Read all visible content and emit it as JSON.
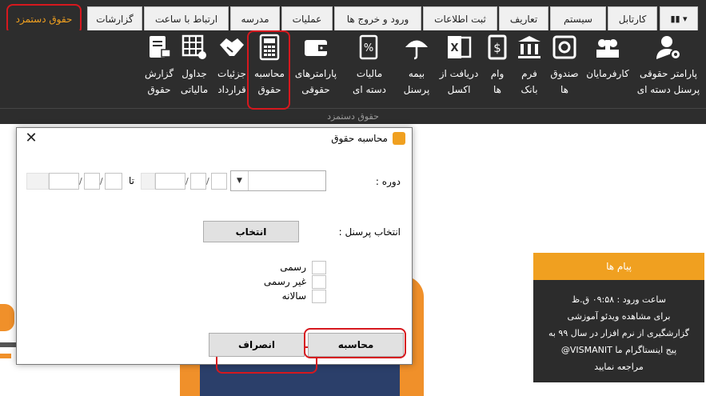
{
  "top_tabs": [
    {
      "label": "",
      "active": false
    },
    {
      "label": "کارتابل",
      "active": false
    },
    {
      "label": "سیستم",
      "active": false
    },
    {
      "label": "تعاریف",
      "active": false
    },
    {
      "label": "ثبت اطلاعات",
      "active": false
    },
    {
      "label": "ورود و خروج ها",
      "active": false
    },
    {
      "label": "عملیات",
      "active": false
    },
    {
      "label": "مدرسه",
      "active": false
    },
    {
      "label": "ارتباط با ساعت",
      "active": false
    },
    {
      "label": "گزارشات",
      "active": false
    },
    {
      "label": "حقوق دستمزد",
      "active": true
    }
  ],
  "ribbon": {
    "group_label": "حقوق دستمزد",
    "buttons": [
      {
        "line1": "پارامتر حقوقی",
        "line2": "پرسنل دسته ای",
        "icon": "user-settings-icon"
      },
      {
        "line1": "کارفرمایان",
        "line2": "",
        "icon": "employers-icon"
      },
      {
        "line1": "صندوق",
        "line2": "ها",
        "icon": "safe-icon"
      },
      {
        "line1": "فرم",
        "line2": "بانک",
        "icon": "bank-icon"
      },
      {
        "line1": "وام",
        "line2": "ها",
        "icon": "loan-icon"
      },
      {
        "line1": "دریافت از",
        "line2": "اکسل",
        "icon": "excel-icon"
      },
      {
        "line1": "بیمه",
        "line2": "پرسنل",
        "icon": "umbrella-icon"
      },
      {
        "line1": "مالیات",
        "line2": "دسته ای",
        "icon": "tax-icon"
      },
      {
        "line1": "پارامترهای",
        "line2": "حقوقی",
        "icon": "wallet-icon"
      },
      {
        "line1": "محاسبه",
        "line2": "حقوق",
        "icon": "calculator-icon"
      },
      {
        "line1": "جزئیات",
        "line2": "قرارداد",
        "icon": "handshake-icon"
      },
      {
        "line1": "جداول",
        "line2": "مالیاتی",
        "icon": "table-icon"
      },
      {
        "line1": "گزارش",
        "line2": "حقوق",
        "icon": "report-icon"
      }
    ]
  },
  "dialog": {
    "title": "محاسبه حقوق",
    "period_label": "دوره :",
    "to_label": "تا",
    "personnel_label": "انتخاب پرسنل :",
    "select_button": "انتخاب",
    "checkboxes": [
      {
        "label": "رسمی",
        "checked": false
      },
      {
        "label": "غیر رسمی",
        "checked": false
      },
      {
        "label": "سالانه",
        "checked": false
      }
    ],
    "calculate_button": "محاسبه",
    "cancel_button": "انصراف"
  },
  "messages": {
    "header": "پیام ها",
    "lines": [
      "ساعت ورود : ۰۹:۵۸ ق.ظ",
      "برای مشاهده ویدئو آموزشی",
      "گزارشگیری از نرم افزار در سال ۹۹ به",
      "پیج اینستاگرام ما VISMANIT@",
      "مراجعه نمایید"
    ]
  },
  "colors": {
    "accent": "#f0a020",
    "ribbon_bg": "#2d2d2d",
    "highlight": "#d6181e"
  }
}
